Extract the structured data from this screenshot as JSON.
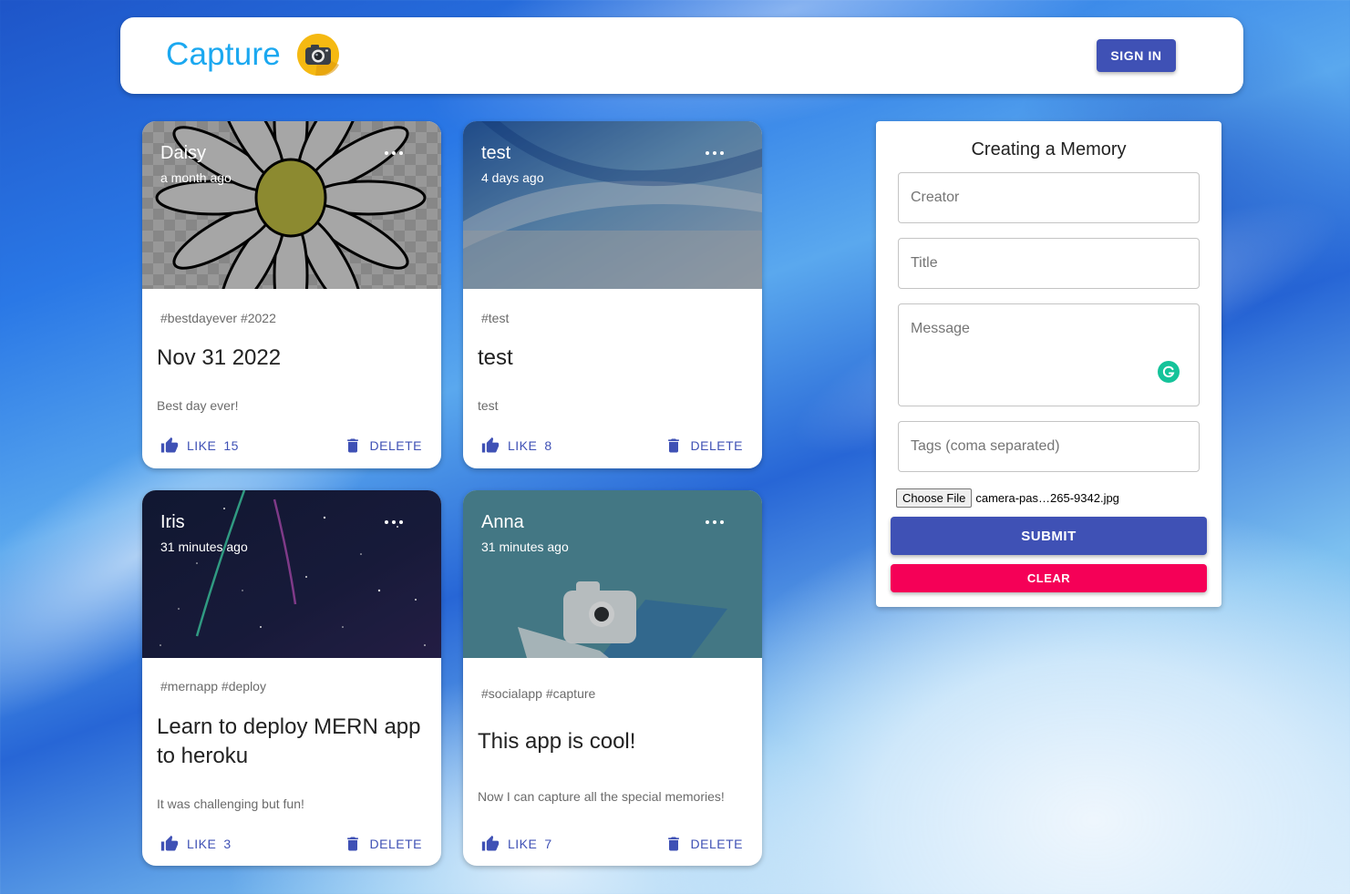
{
  "header": {
    "title": "Capture",
    "logo_icon": "camera-icon",
    "signin_label": "SIGN IN"
  },
  "posts": [
    {
      "creator": "Daisy",
      "time": "a month ago",
      "tags": "#bestdayever #2022",
      "title": "Nov 31 2022",
      "message": "Best day ever!",
      "like_label": "LIKE",
      "likes": "15",
      "delete_label": "DELETE",
      "image": "daisy-flower-drawing"
    },
    {
      "creator": "test",
      "time": "4 days ago",
      "tags": "#test",
      "title": "test",
      "message": "test",
      "like_label": "LIKE",
      "likes": "8",
      "delete_label": "DELETE",
      "image": "blue-abstract"
    },
    {
      "creator": "Iris",
      "time": "31 minutes ago",
      "tags": "#mernapp #deploy",
      "title": "Learn to deploy MERN app to heroku",
      "message": "It was challenging but fun!",
      "like_label": "LIKE",
      "likes": "3",
      "delete_label": "DELETE",
      "image": "night-sky-meteors"
    },
    {
      "creator": "Anna",
      "time": "31 minutes ago",
      "tags": "#socialapp #capture",
      "title": "This app is cool!",
      "message": "Now I can capture all the special memories!",
      "like_label": "LIKE",
      "likes": "7",
      "delete_label": "DELETE",
      "image": "camera-teal"
    }
  ],
  "form": {
    "title": "Creating a Memory",
    "creator_placeholder": "Creator",
    "title_placeholder": "Title",
    "message_placeholder": "Message",
    "tags_placeholder": "Tags (coma separated)",
    "choose_file_label": "Choose File",
    "file_name": "camera-pas…265-9342.jpg",
    "submit_label": "SUBMIT",
    "clear_label": "CLEAR"
  },
  "colors": {
    "primary": "#3f51b5",
    "secondary": "#f50057",
    "brand": "#1ba8f0"
  }
}
